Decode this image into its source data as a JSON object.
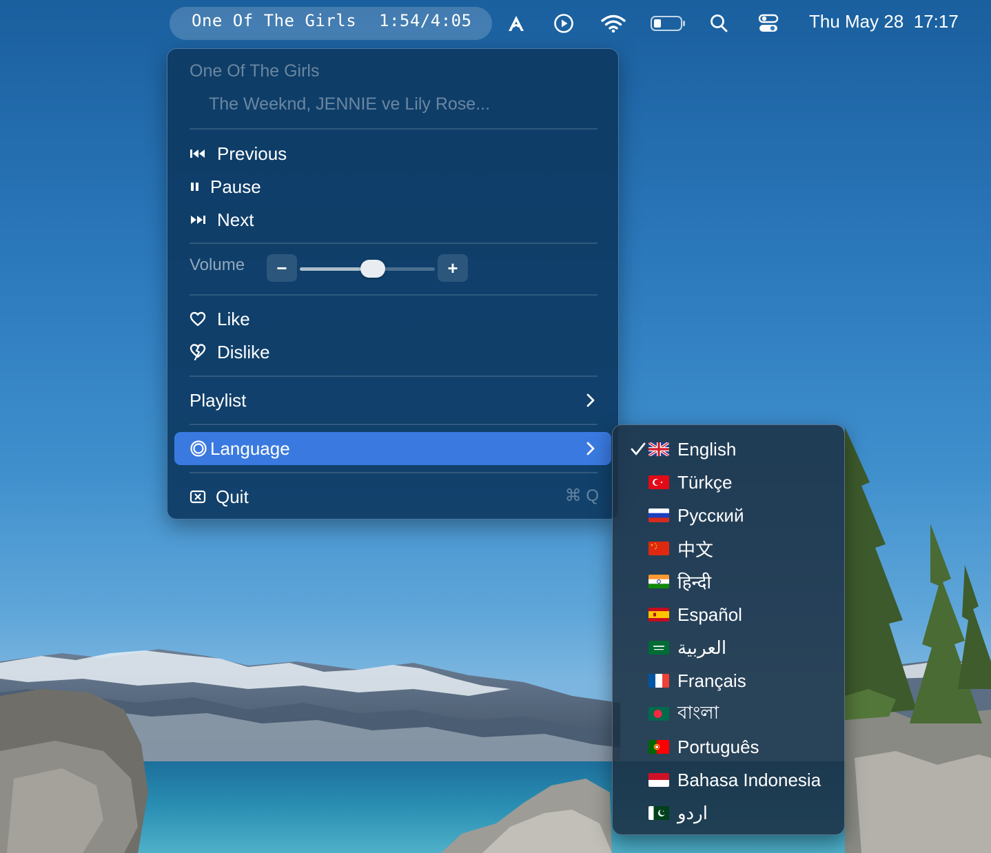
{
  "menubar": {
    "now_playing_title": "One Of The Girls",
    "now_playing_time": "1:54/4:05",
    "icons": [
      "app-a-icon",
      "play-circle-icon",
      "wifi-icon",
      "battery-icon",
      "search-icon",
      "control-center-icon"
    ],
    "date": "Thu May 28",
    "time": "17:17"
  },
  "menu": {
    "song_title": "One Of The Girls",
    "song_artist": "The Weeknd, JENNIE ve Lily Rose...",
    "previous": "Previous",
    "pause": "Pause",
    "next": "Next",
    "volume_label": "Volume",
    "volume_minus": "−",
    "volume_plus": "+",
    "volume_level": 0.55,
    "like": "Like",
    "dislike": "Dislike",
    "playlist": "Playlist",
    "language": "Language",
    "quit": "Quit",
    "quit_shortcut": "⌘ Q"
  },
  "languages": {
    "selected": "English",
    "items": [
      {
        "label": "English",
        "flag": "uk"
      },
      {
        "label": "Türkçe",
        "flag": "tr"
      },
      {
        "label": "Русский",
        "flag": "ru"
      },
      {
        "label": "中文",
        "flag": "cn"
      },
      {
        "label": "हिन्दी",
        "flag": "in"
      },
      {
        "label": "Español",
        "flag": "es"
      },
      {
        "label": "العربية",
        "flag": "sa"
      },
      {
        "label": "Français",
        "flag": "fr"
      },
      {
        "label": "বাংলা",
        "flag": "bd"
      },
      {
        "label": "Português",
        "flag": "pt"
      },
      {
        "label": "Bahasa Indonesia",
        "flag": "id"
      },
      {
        "label": "اردو",
        "flag": "pk"
      }
    ]
  },
  "colors": {
    "highlight": "#3a7ae0",
    "menu_bg": "#0c3860",
    "submenu_bg": "#1c3042"
  }
}
